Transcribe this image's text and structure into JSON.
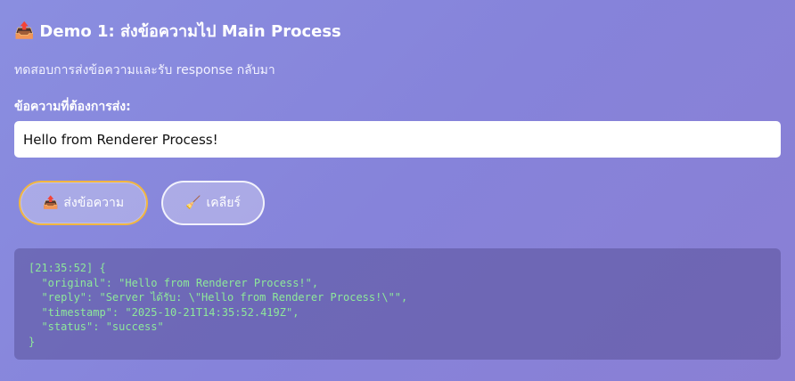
{
  "demo": {
    "title_icon": "📤",
    "title": "Demo 1: ส่งข้อความไป Main Process",
    "description": "ทดสอบการส่งข้อความและรับ response กลับมา",
    "input_label": "ข้อความที่ต้องการส่ง:",
    "input_value": "Hello from Renderer Process!",
    "send_button": {
      "icon": "📤",
      "label": "ส่งข้อความ"
    },
    "clear_button": {
      "icon": "🧹",
      "label": "เคลียร์"
    },
    "output_lines": [
      "[21:35:52] {",
      "  \"original\": \"Hello from Renderer Process!\",",
      "  \"reply\": \"Server ได้รับ: \\\"Hello from Renderer Process!\\\"\",",
      "  \"timestamp\": \"2025-10-21T14:35:52.419Z\",",
      "  \"status\": \"success\"",
      "}"
    ]
  },
  "colors": {
    "output_text": "#8ee89a",
    "send_border": "#f2b640"
  }
}
